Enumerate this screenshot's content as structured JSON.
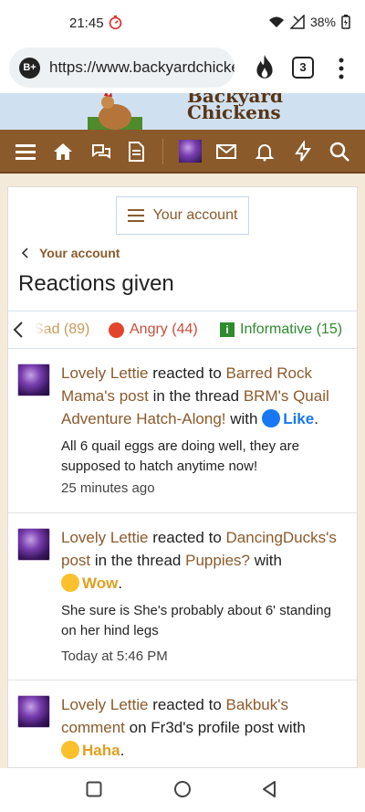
{
  "status": {
    "time": "21:45",
    "battery": "38%"
  },
  "browser": {
    "badge": "B+",
    "url": "https://www.backyardchickens",
    "tab_count": "3"
  },
  "banner": {
    "logo_line1": "Backyard",
    "logo_line2": "Chickens"
  },
  "account": {
    "button_label": "Your account",
    "breadcrumb": "Your account",
    "title": "Reactions given"
  },
  "tabs": [
    {
      "label": "Sad (89)"
    },
    {
      "label": "Angry (44)"
    },
    {
      "label": "Informative (15)"
    }
  ],
  "feed": [
    {
      "user": "Lovely Lettie",
      "reacted_to": "reacted to",
      "target": "Barred Rock Mama's post",
      "in_thread": "in the thread",
      "thread": "BRM's Quail Adventure Hatch-Along!",
      "with": "with",
      "reaction": "Like",
      "snippet": "All 6 quail eggs are doing well, they are supposed to hatch anytime now!",
      "time": "25 minutes ago"
    },
    {
      "user": "Lovely Lettie",
      "reacted_to": "reacted to",
      "target": "DancingDucks's post",
      "in_thread": "in the thread",
      "thread": "Puppies?",
      "with": "with",
      "reaction": "Wow",
      "snippet": "She sure is She's probably about 6' standing on her hind legs",
      "time": "Today at 5:46 PM"
    },
    {
      "user": "Lovely Lettie",
      "reacted_to": "reacted to",
      "target": "Bakbuk's comment",
      "on_profile": "on Fr3d's profile post with",
      "reaction": "Haha"
    }
  ],
  "colors": {
    "brand_brown": "#8b5a2b",
    "page_bg": "#f4ead9",
    "like_blue": "#1877f2",
    "wow_gold": "#e0a020"
  }
}
